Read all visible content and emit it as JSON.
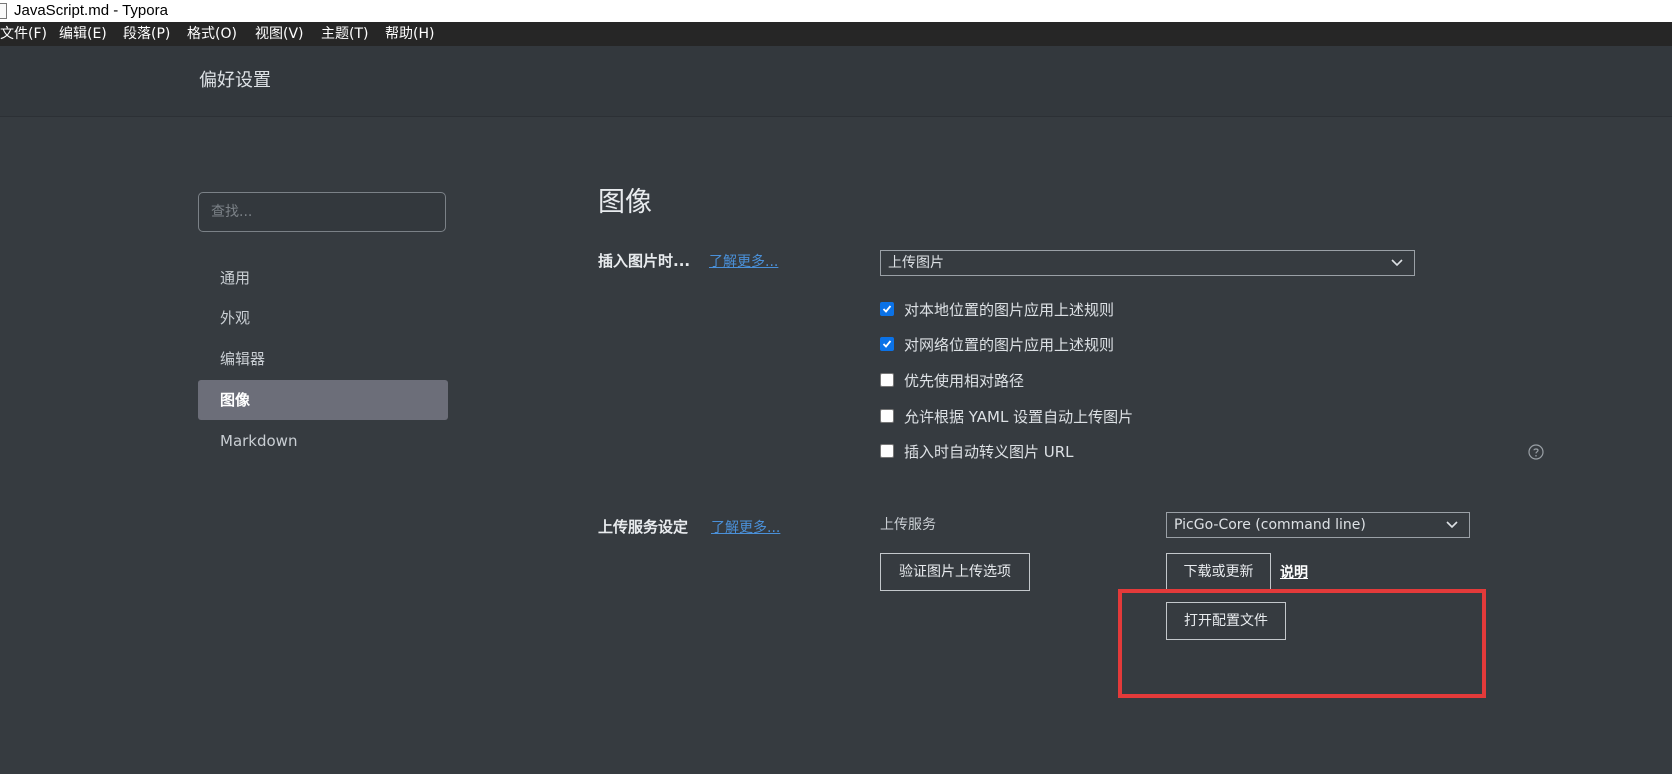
{
  "window": {
    "title": "JavaScript.md - Typora"
  },
  "menu": [
    "文件(F)",
    "编辑(E)",
    "段落(P)",
    "格式(O)",
    "视图(V)",
    "主题(T)",
    "帮助(H)"
  ],
  "header": {
    "title": "偏好设置"
  },
  "sidebar": {
    "search_placeholder": "查找...",
    "items": [
      {
        "label": "通用",
        "active": false
      },
      {
        "label": "外观",
        "active": false
      },
      {
        "label": "编辑器",
        "active": false
      },
      {
        "label": "图像",
        "active": true
      },
      {
        "label": "Markdown",
        "active": false
      }
    ]
  },
  "main": {
    "section_title": "图像",
    "insert": {
      "label": "插入图片时...",
      "learn_more": "了解更多...",
      "select_value": "上传图片",
      "options": [
        {
          "label": "对本地位置的图片应用上述规则",
          "checked": true
        },
        {
          "label": "对网络位置的图片应用上述规则",
          "checked": true
        },
        {
          "label": "优先使用相对路径",
          "checked": false
        },
        {
          "label": "允许根据 YAML 设置自动上传图片",
          "checked": false
        },
        {
          "label": "插入时自动转义图片 URL",
          "checked": false
        }
      ]
    },
    "upload": {
      "label": "上传服务设定",
      "learn_more": "了解更多...",
      "service_label": "上传服务",
      "service_value": "PicGo-Core (command line)",
      "verify_button": "验证图片上传选项",
      "download_button": "下载或更新",
      "docs_link": "说明",
      "open_config_button": "打开配置文件"
    }
  },
  "colors": {
    "background": "#363b40",
    "checkbox_accent": "#0b72e7",
    "highlight": "#e33a3a",
    "link": "#4a90d9"
  }
}
